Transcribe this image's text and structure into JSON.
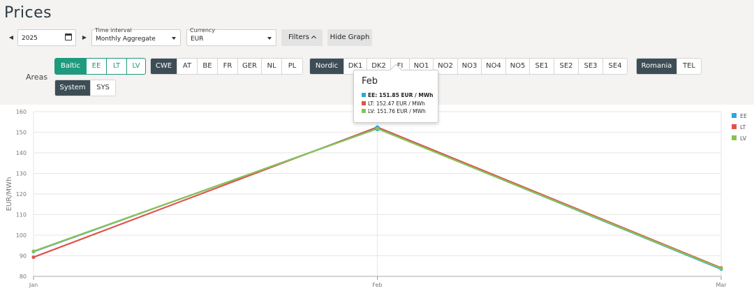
{
  "page": {
    "title": "Prices"
  },
  "controls": {
    "prev_icon": "caret-left-icon",
    "next_icon": "caret-right-icon",
    "year": "2025",
    "time_interval": {
      "label": "Time interval",
      "value": "Monthly Aggregate"
    },
    "currency": {
      "label": "Currency",
      "value": "EUR"
    },
    "filters_label": "Filters",
    "hide_graph_label": "Hide Graph"
  },
  "areas": {
    "label": "Areas",
    "baltic": [
      "Baltic",
      "EE",
      "LT",
      "LV"
    ],
    "cwe": [
      "CWE",
      "AT",
      "BE",
      "FR",
      "GER",
      "NL",
      "PL"
    ],
    "nordic": [
      "Nordic",
      "DK1",
      "DK2",
      "FI",
      "NO1",
      "NO2",
      "NO3",
      "NO4",
      "NO5",
      "SE1",
      "SE2",
      "SE3",
      "SE4"
    ],
    "romania": [
      "Romania",
      "TEL"
    ],
    "system": [
      "System",
      "SYS"
    ]
  },
  "colors": {
    "EE": "#29a8e0",
    "LT": "#e0534a",
    "LV": "#8cc152",
    "teal": "#1e9a7c",
    "dark": "#3d4d55"
  },
  "tooltip": {
    "title": "Feb",
    "rows": [
      "EE: 151.85 EUR / MWh",
      "LT: 152.47 EUR / MWh",
      "LV: 151.76 EUR / MWh"
    ]
  },
  "chart_data": {
    "type": "line",
    "x": [
      "Jan",
      "Feb",
      "Mar"
    ],
    "ylabel": "EUR/MWh",
    "ylim": [
      80,
      160
    ],
    "yticks": [
      80,
      90,
      100,
      110,
      120,
      130,
      140,
      150,
      160
    ],
    "grid": true,
    "legend_position": "right",
    "series": [
      {
        "name": "EE",
        "values": [
          92.0,
          151.85,
          83.5
        ]
      },
      {
        "name": "LT",
        "values": [
          89.3,
          152.47,
          84.1
        ]
      },
      {
        "name": "LV",
        "values": [
          92.2,
          151.76,
          83.8
        ]
      }
    ]
  }
}
